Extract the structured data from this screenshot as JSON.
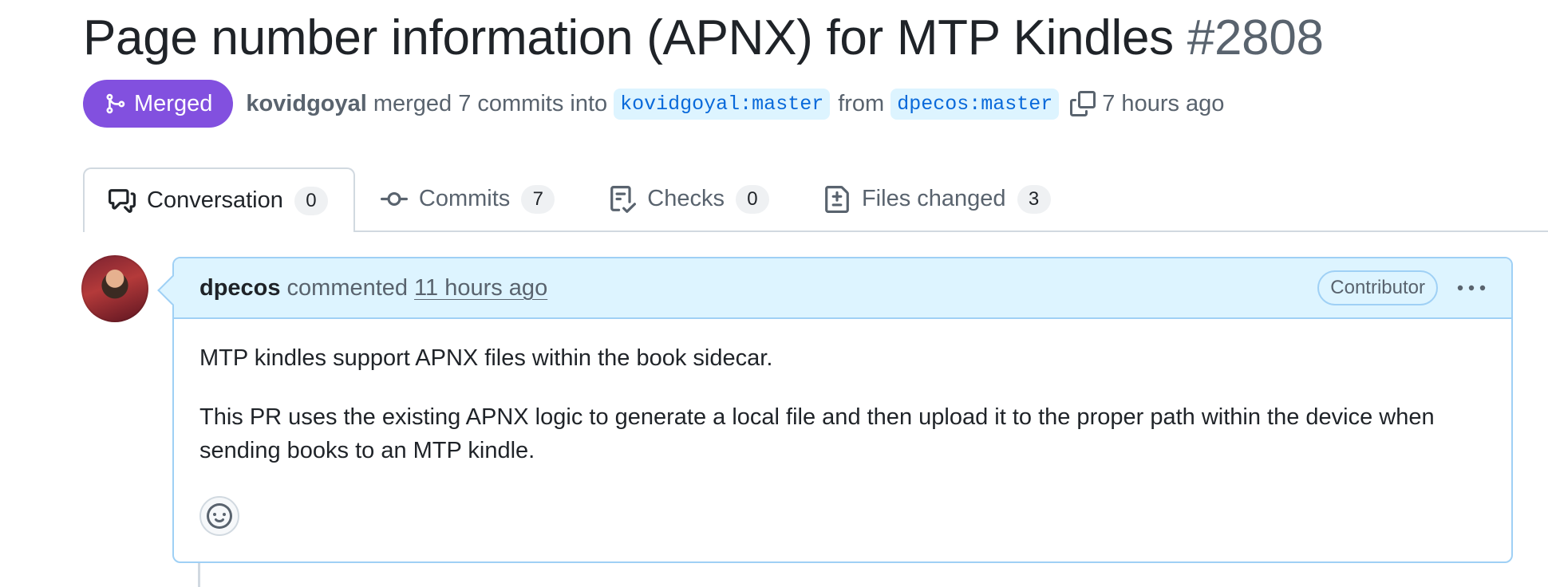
{
  "pr": {
    "title": "Page number information (APNX) for MTP Kindles",
    "number": "#2808"
  },
  "meta": {
    "state": "Merged",
    "state_color": "#8250df",
    "merger": "kovidgoyal",
    "merged_text": "merged 7 commits into",
    "base_branch": "kovidgoyal:master",
    "from_text": "from",
    "head_branch": "dpecos:master",
    "time": "7 hours ago"
  },
  "tabs": [
    {
      "label": "Conversation",
      "count": "0",
      "icon": "comment-discussion-icon"
    },
    {
      "label": "Commits",
      "count": "7",
      "icon": "git-commit-icon"
    },
    {
      "label": "Checks",
      "count": "0",
      "icon": "checklist-icon"
    },
    {
      "label": "Files changed",
      "count": "3",
      "icon": "file-diff-icon"
    }
  ],
  "comment": {
    "author": "dpecos",
    "action": "commented",
    "time": "11 hours ago",
    "role": "Contributor",
    "body": [
      "MTP kindles support APNX files within the book sidecar.",
      "This PR uses the existing APNX logic to generate a local file and then upload it to the proper path within the device when sending books to an MTP kindle."
    ]
  }
}
